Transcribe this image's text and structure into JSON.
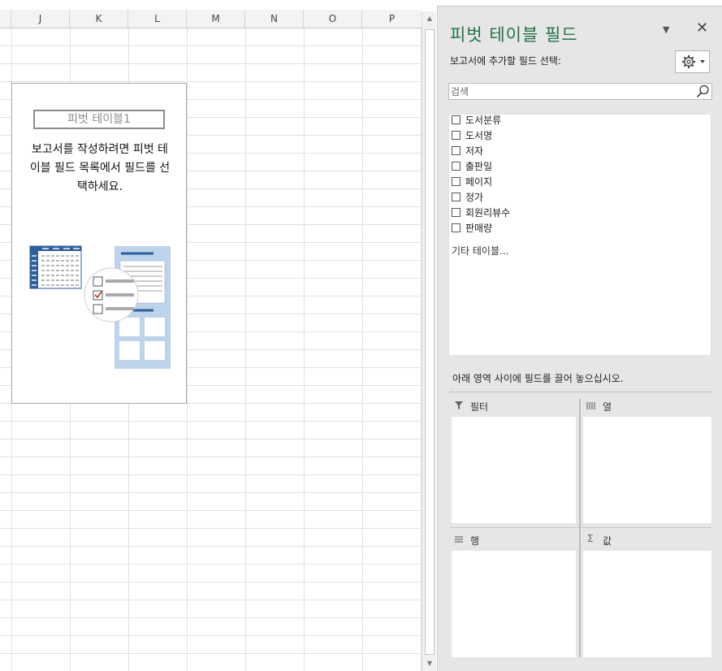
{
  "sheet": {
    "columns": [
      "J",
      "K",
      "L",
      "M",
      "N",
      "O",
      "P"
    ],
    "pivot_placeholder": {
      "name": "피벗 테이블1",
      "instruction_line1": "보고서를 작성하려면 피벗 테",
      "instruction_line2": "이블 필드 목록에서 필드를 선",
      "instruction_line3": "택하세요."
    }
  },
  "pane": {
    "title": "피벗 테이블 필드",
    "choose_label": "보고서에 추가할 필드 선택:",
    "search_placeholder": "검색",
    "fields": [
      {
        "label": "도서분류",
        "checked": false
      },
      {
        "label": "도서명",
        "checked": false
      },
      {
        "label": "저자",
        "checked": false
      },
      {
        "label": "출판일",
        "checked": false
      },
      {
        "label": "페이지",
        "checked": false
      },
      {
        "label": "정가",
        "checked": false
      },
      {
        "label": "회원리뷰수",
        "checked": false
      },
      {
        "label": "판매량",
        "checked": false
      }
    ],
    "more_tables": "기타 테이블...",
    "drag_label": "아래 영역 사이에 필드를 끌어 놓으십시오.",
    "areas": {
      "filter": "필터",
      "columns": "열",
      "rows": "행",
      "values": "값"
    },
    "accent_color": "#217346"
  }
}
